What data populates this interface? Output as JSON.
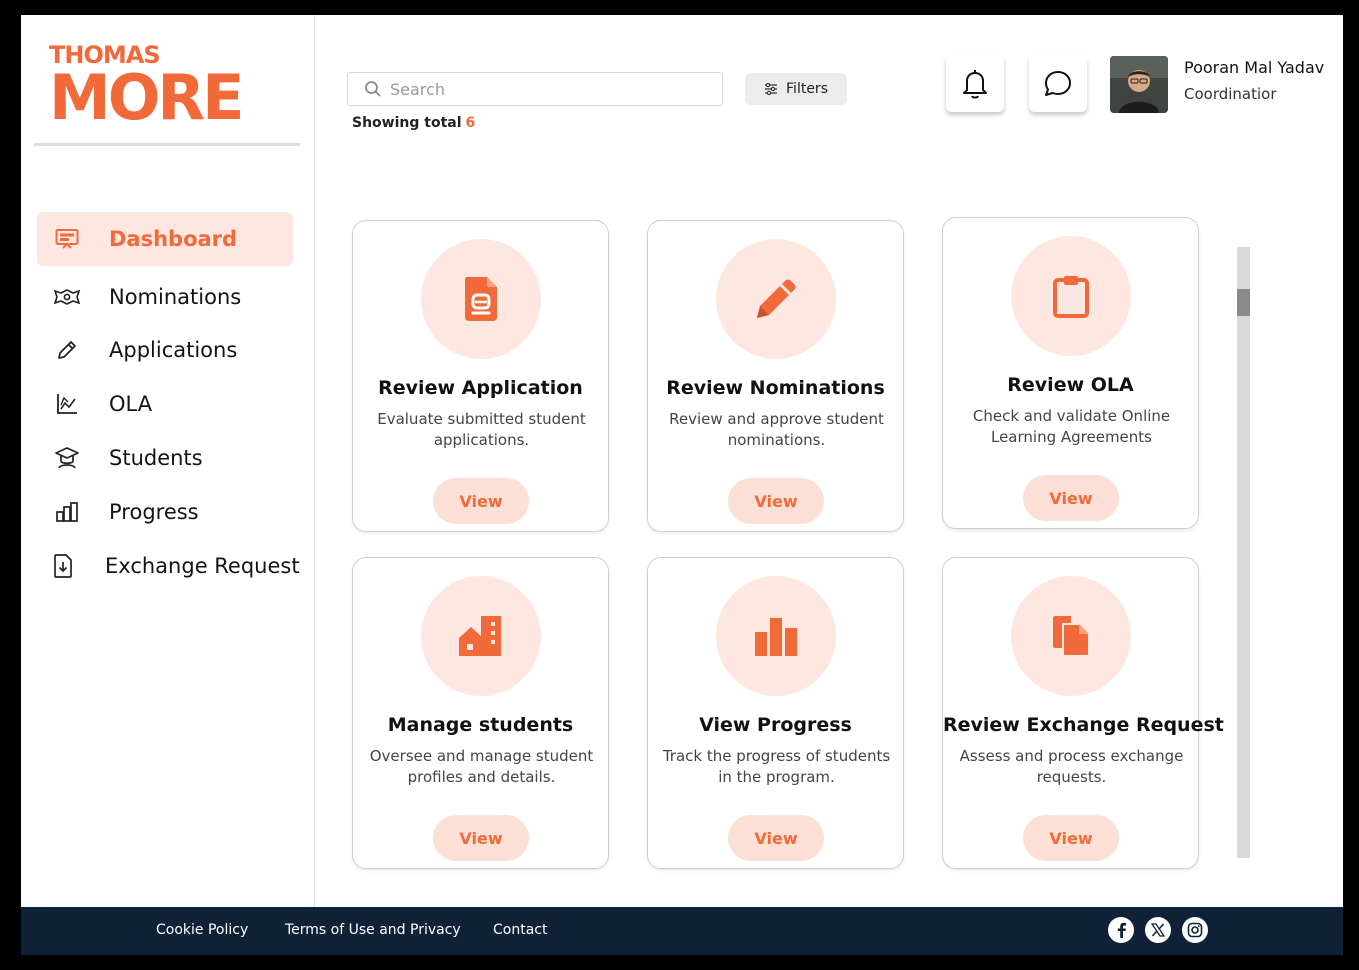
{
  "brand": {
    "line1": "THOMAS",
    "line2": "MORE",
    "accent": "#f26a3a"
  },
  "sidebar": {
    "items": [
      {
        "label": "Dashboard",
        "icon": "monitor-icon",
        "active": true
      },
      {
        "label": "Nominations",
        "icon": "ticket-icon",
        "active": false
      },
      {
        "label": "Applications",
        "icon": "pencil-icon",
        "active": false
      },
      {
        "label": "OLA",
        "icon": "chart-line-icon",
        "active": false
      },
      {
        "label": "Students",
        "icon": "graduation-cap-icon",
        "active": false
      },
      {
        "label": "Progress",
        "icon": "bar-chart-icon",
        "active": false
      },
      {
        "label": "Exchange Request",
        "icon": "download-file-icon",
        "active": false
      }
    ]
  },
  "search": {
    "placeholder": "Search",
    "value": ""
  },
  "filters": {
    "label": "Filters"
  },
  "summary": {
    "label": "Showing total",
    "count": "6"
  },
  "user": {
    "name": "Pooran Mal Yadav",
    "role": "Coordinatior"
  },
  "cards": [
    {
      "title": "Review Application",
      "description": "Evaluate submitted student applications.",
      "button": "View",
      "icon": "document-icon"
    },
    {
      "title": "Review Nominations",
      "description": "Review and approve student nominations.",
      "button": "View",
      "icon": "pencil-icon"
    },
    {
      "title": "Review OLA",
      "description": "Check and validate Online Learning Agreements",
      "button": "View",
      "icon": "clipboard-icon"
    },
    {
      "title": "Manage students",
      "description": "Oversee and manage student profiles and details.",
      "button": "View",
      "icon": "buildings-icon"
    },
    {
      "title": "View Progress",
      "description": "Track the progress of students in the program.",
      "button": "View",
      "icon": "bar-chart-icon"
    },
    {
      "title": "Review Exchange Request",
      "description": "Assess and process exchange requests.",
      "button": "View",
      "icon": "copy-files-icon"
    }
  ],
  "footer": {
    "links": [
      "Cookie Policy",
      "Terms of Use and Privacy",
      "Contact"
    ],
    "social": [
      "facebook-icon",
      "x-icon",
      "instagram-icon"
    ],
    "background": "#0f2238"
  }
}
